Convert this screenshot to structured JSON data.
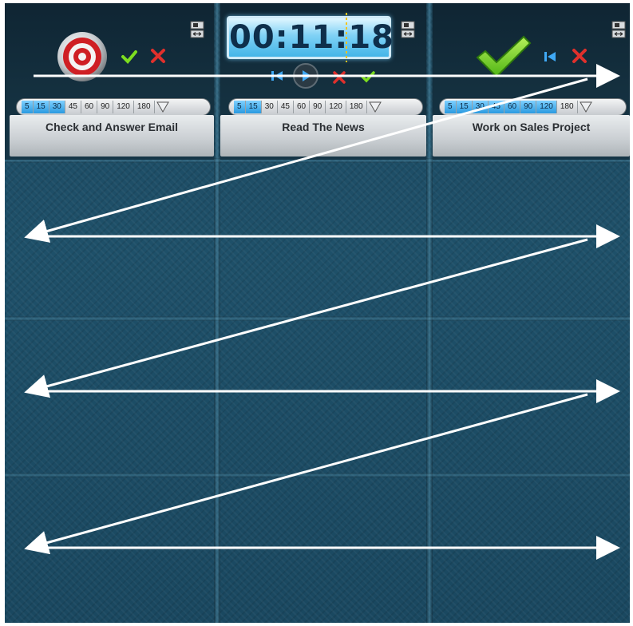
{
  "timer": {
    "display": "00:11:18"
  },
  "duration_options": [
    "5",
    "15",
    "30",
    "45",
    "60",
    "90",
    "120",
    "180"
  ],
  "columns": [
    {
      "task": "Check and Answer Email",
      "selected_upto": 3
    },
    {
      "task": "Read The News",
      "selected_upto": 2
    },
    {
      "task": "Work on Sales Project",
      "selected_upto": 7
    }
  ],
  "colors": {
    "check_green": "#7dde1f",
    "cancel_red": "#e0302c",
    "accent_blue": "#2a9ae0",
    "arrow": "#ffffff"
  },
  "icons": [
    "target-icon",
    "check-icon",
    "close-icon",
    "skip-back-icon",
    "play-icon",
    "expand-icon",
    "big-check-icon"
  ]
}
